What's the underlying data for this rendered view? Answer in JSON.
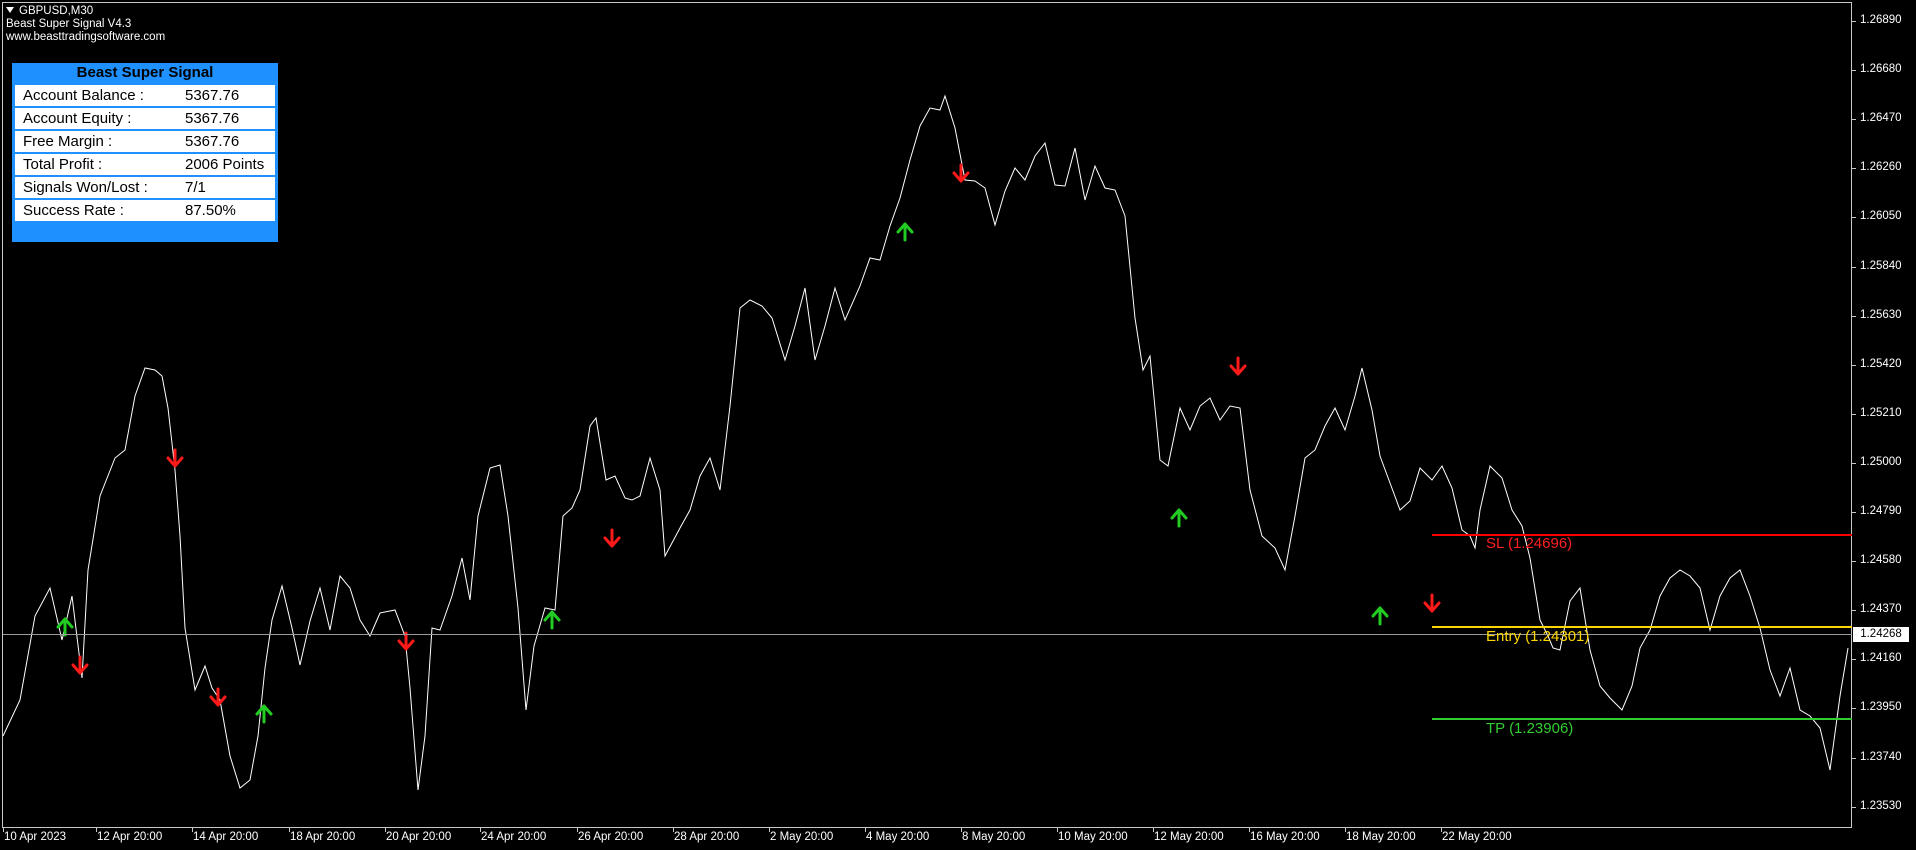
{
  "header": {
    "symbol": "GBPUSD,M30",
    "indicator_name": "Beast Super Signal V4.3",
    "website": "www.beasttradingsoftware.com"
  },
  "info_panel": {
    "title": "Beast Super Signal",
    "rows": [
      {
        "label": "Account Balance :",
        "value": "5367.76"
      },
      {
        "label": "Account Equity :",
        "value": "5367.76"
      },
      {
        "label": "Free Margin :",
        "value": "5367.76"
      },
      {
        "label": "Total Profit :",
        "value": "2006 Points"
      },
      {
        "label": "Signals Won/Lost :",
        "value": "7/1"
      },
      {
        "label": "Success Rate :",
        "value": "87.50%"
      }
    ]
  },
  "price_axis": {
    "labels": [
      "1.26890",
      "1.26680",
      "1.26470",
      "1.26260",
      "1.26050",
      "1.25840",
      "1.25630",
      "1.25420",
      "1.25210",
      "1.25000",
      "1.24790",
      "1.24580",
      "1.24370",
      "1.24160",
      "1.23950",
      "1.23740",
      "1.23530"
    ],
    "current_price": "1.24268"
  },
  "time_axis": {
    "labels": [
      "10 Apr 2023",
      "12 Apr 20:00",
      "14 Apr 20:00",
      "18 Apr 20:00",
      "20 Apr 20:00",
      "24 Apr 20:00",
      "26 Apr 20:00",
      "28 Apr 20:00",
      "2 May 20:00",
      "4 May 20:00",
      "8 May 20:00",
      "10 May 20:00",
      "12 May 20:00",
      "16 May 20:00",
      "18 May 20:00",
      "22 May 20:00"
    ]
  },
  "levels": {
    "sl": {
      "label": "SL (1.24696)",
      "price": 1.24696,
      "color": "#ff0000"
    },
    "entry": {
      "label": "Entry (1.24301)",
      "price": 1.24301,
      "color": "#ffd700"
    },
    "tp": {
      "label": "TP (1.23906)",
      "price": 1.23906,
      "color": "#32cd32"
    }
  },
  "signals": {
    "buy_color": "#22cc22",
    "sell_color": "#ff1a1a",
    "buy_icon": "arrow-up-icon",
    "sell_icon": "arrow-down-icon"
  },
  "colors": {
    "background": "#000000",
    "price_line": "#ffffff",
    "panel_accent": "#1e90ff"
  }
}
